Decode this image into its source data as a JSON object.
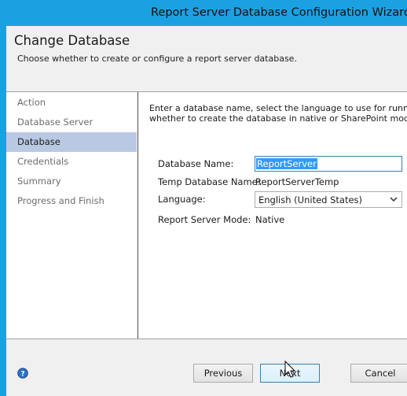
{
  "window": {
    "title": "Report Server Database Configuration Wizard"
  },
  "header": {
    "title": "Change Database",
    "subtitle": "Choose whether to create or configure a report server database."
  },
  "nav": {
    "items": [
      {
        "label": "Action"
      },
      {
        "label": "Database Server"
      },
      {
        "label": "Database"
      },
      {
        "label": "Credentials"
      },
      {
        "label": "Summary"
      },
      {
        "label": "Progress and Finish"
      }
    ],
    "selected": "Database"
  },
  "content": {
    "intro_line1": "Enter a database name, select the language to use for running SQL",
    "intro_line2": "whether to create the database in native or SharePoint mode.",
    "fields": {
      "db_name_label": "Database Name:",
      "db_name_value": "ReportServer",
      "temp_db_label": "Temp Database Name:",
      "temp_db_value": "ReportServerTemp",
      "language_label": "Language:",
      "language_value": "English (United States)",
      "mode_label": "Report Server Mode:",
      "mode_value": "Native"
    }
  },
  "footer": {
    "previous_label": "Previous",
    "next_label": "Next",
    "cancel_label": "Cancel"
  },
  "icons": {
    "help": "help-icon",
    "dropdown": "chevron-down-icon",
    "cursor": "mouse-cursor-icon"
  },
  "colors": {
    "titlebar": "#1ba1e2",
    "selection": "#b9c9e3",
    "accent_border": "#3c7fb1"
  }
}
